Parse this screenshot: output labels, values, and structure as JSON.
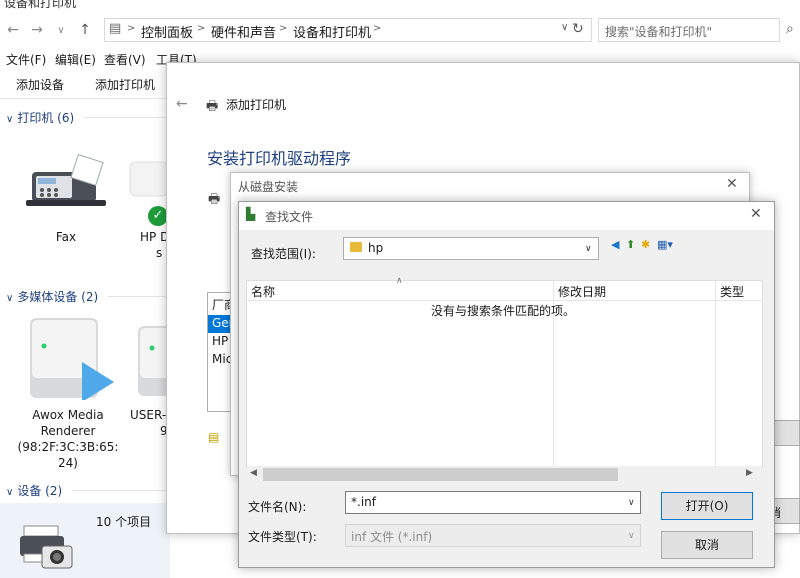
{
  "window": {
    "title": "设备和打印机"
  },
  "address": {
    "crumbs": [
      "控制面板",
      "硬件和声音",
      "设备和打印机"
    ],
    "search_placeholder": "搜索\"设备和打印机\""
  },
  "menu": {
    "items": [
      "文件(F)",
      "编辑(E)",
      "查看(V)",
      "工具(T)"
    ]
  },
  "commands": {
    "add_device": "添加设备",
    "add_printer": "添加打印机"
  },
  "groups": {
    "printers": "打印机 (6)",
    "multimedia": "多媒体设备 (2)",
    "devices": "设备 (2)"
  },
  "devices": {
    "fax": "Fax",
    "hp_partial": "HP D",
    "hp_partial2": "s",
    "awox_l1": "Awox Media",
    "awox_l2": "Renderer",
    "awox_l3": "(98:2F:3C:3B:65:",
    "awox_l4": "24)",
    "user_partial": "USER-",
    "user_partial2": "9"
  },
  "status": {
    "count": "10 个项目"
  },
  "wizard": {
    "title": "添加打印机",
    "heading": "安装打印机驱动程序",
    "list_items": [
      "厂商",
      "Gen",
      "HP",
      "Mic"
    ],
    "right_btn_partial": "消"
  },
  "disk_dialog": {
    "title": "从磁盘安装"
  },
  "find_dialog": {
    "title": "查找文件",
    "lookin_label": "查找范围(I):",
    "lookin_value": "hp",
    "columns": [
      "名称",
      "修改日期",
      "类型"
    ],
    "empty_message": "没有与搜索条件匹配的项。",
    "filename_label": "文件名(N):",
    "filename_value": "*.inf",
    "filetype_label": "文件类型(T):",
    "filetype_value": "inf 文件 (*.inf)",
    "open_button": "打开(O)",
    "cancel_button": "取消"
  }
}
